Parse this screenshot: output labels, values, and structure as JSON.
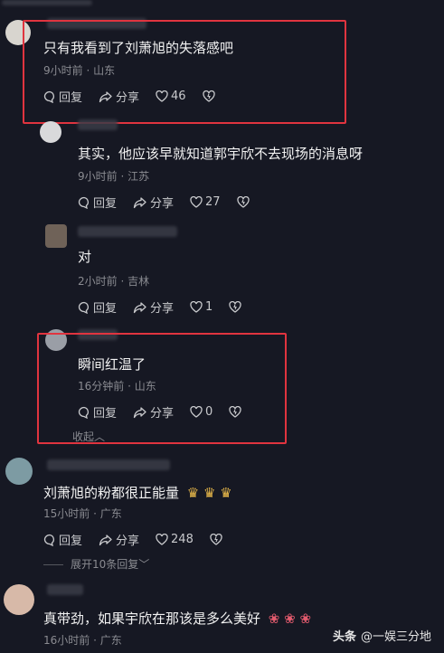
{
  "comments": [
    {
      "text": "只有我看到了刘萧旭的失落感吧",
      "meta": "9小时前 · 山东",
      "reply_label": "回复",
      "share_label": "分享",
      "likes": "46"
    },
    {
      "text": "其实，他应该早就知道郭宇欣不去现场的消息呀",
      "meta": "9小时前 · 江苏",
      "reply_label": "回复",
      "share_label": "分享",
      "likes": "27"
    },
    {
      "text": "对",
      "meta": "2小时前 · 吉林",
      "reply_label": "回复",
      "share_label": "分享",
      "likes": "1"
    },
    {
      "text": "瞬间红温了",
      "meta": "16分钟前 · 山东",
      "reply_label": "回复",
      "share_label": "分享",
      "likes": "0"
    },
    {
      "text": "刘萧旭的粉都很正能量",
      "meta": "15小时前 · 广东",
      "reply_label": "回复",
      "share_label": "分享",
      "likes": "248"
    },
    {
      "text": "真带劲，如果宇欣在那该是多么美好",
      "meta": "16小时前 · 广东"
    }
  ],
  "collapse_label": "收起",
  "expand_replies_label": "展开10条回复",
  "watermark": {
    "brand": "头条",
    "account": "@一娱三分地"
  },
  "colors": {
    "background": "#161823",
    "highlight_box": "#e0343f"
  }
}
